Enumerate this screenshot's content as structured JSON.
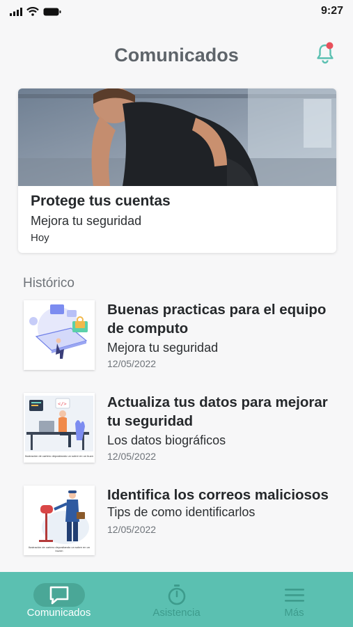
{
  "status_bar": {
    "time": "9:27"
  },
  "header": {
    "title": "Comunicados",
    "bell_has_badge": true
  },
  "featured": {
    "title": "Protege tus cuentas",
    "subtitle": "Mejora tu seguridad",
    "date": "Hoy"
  },
  "history": {
    "title": "Histórico",
    "items": [
      {
        "title": "Buenas practicas para el equipo de computo",
        "subtitle": "Mejora tu seguridad",
        "date": "12/05/2022"
      },
      {
        "title": "Actualiza tus datos para mejorar tu seguridad",
        "subtitle": "Los datos biográficos",
        "date": "12/05/2022",
        "thumb_caption": "Ilustración de cartero depositando un sobre en un buzón"
      },
      {
        "title": "Identifica los correos maliciosos",
        "subtitle": "Tips de como identificarlos",
        "date": "12/05/2022",
        "thumb_caption": "Ilustración de cartero depositando un sobre en un buzón"
      }
    ]
  },
  "tab_bar": {
    "tabs": [
      {
        "label": "Comunicados",
        "icon": "chat-bubble-icon",
        "active": true
      },
      {
        "label": "Asistencia",
        "icon": "stopwatch-icon",
        "active": false
      },
      {
        "label": "Más",
        "icon": "menu-icon",
        "active": false
      }
    ]
  },
  "colors": {
    "accent": "#5bc0b1",
    "accent_dark": "#4aa797",
    "badge": "#e8505b",
    "inactive_tab": "#3d9b8c"
  }
}
